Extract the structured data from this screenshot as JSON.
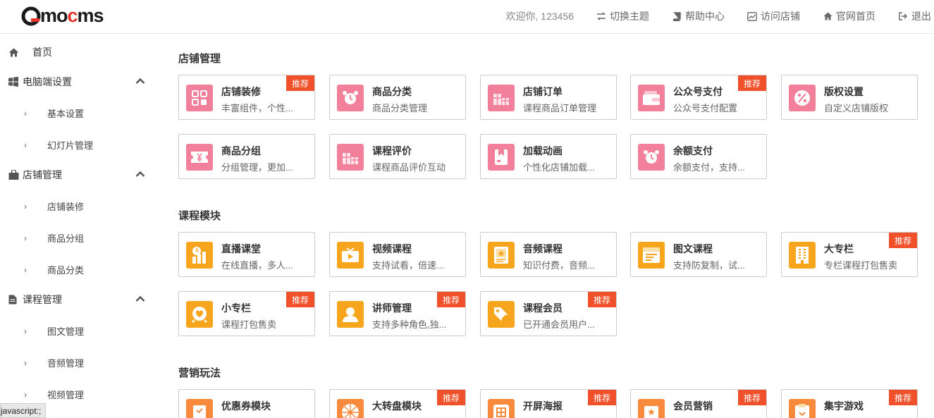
{
  "header": {
    "logo": "Qmocms",
    "welcome": "欢迎你, 123456",
    "switch_theme": "切换主题",
    "help_center": "帮助中心",
    "visit_store": "访问店铺",
    "official_home": "官网首页",
    "logout": "退出"
  },
  "sidebar": {
    "home": "首页",
    "pc_settings": "电脑端设置",
    "pc_basic": "基本设置",
    "pc_slides": "幻灯片管理",
    "store_mgmt": "店铺管理",
    "store_decor": "店铺装修",
    "store_group": "商品分组",
    "store_category": "商品分类",
    "course_mgmt": "课程管理",
    "course_article": "图文管理",
    "course_audio": "音频管理",
    "course_video": "视频管理"
  },
  "status_bar": "javascript:;",
  "badge_label": "推荐",
  "sections": {
    "store": {
      "title": "店铺管理",
      "cards": [
        {
          "title": "店铺装修",
          "desc": "丰富组件，个性...",
          "icon": "qr-grid-icon",
          "badge": true
        },
        {
          "title": "商品分类",
          "desc": "商品分类管理",
          "icon": "alarm-clock-icon",
          "badge": false
        },
        {
          "title": "店铺订单",
          "desc": "课程商品订单管理",
          "icon": "gift-boxes-icon",
          "badge": false
        },
        {
          "title": "公众号支付",
          "desc": "公众号支付配置",
          "icon": "wallet-icon",
          "badge": true
        },
        {
          "title": "版权设置",
          "desc": "自定义店铺版权",
          "icon": "percent-icon",
          "badge": false
        },
        {
          "title": "商品分组",
          "desc": "分组管理，更加...",
          "icon": "yen-ticket-icon",
          "badge": false
        },
        {
          "title": "课程评价",
          "desc": "课程商品评价互动",
          "icon": "gift-boxes-icon",
          "badge": false
        },
        {
          "title": "加载动画",
          "desc": "个性化店铺加载...",
          "icon": "bookmark-icon",
          "badge": false
        },
        {
          "title": "余额支付",
          "desc": "余额支付，支持...",
          "icon": "alarm-clock-icon",
          "badge": false
        }
      ]
    },
    "course": {
      "title": "课程模块",
      "cards": [
        {
          "title": "直播课堂",
          "desc": "在线直播，多人...",
          "icon": "live-chart-icon",
          "badge": false
        },
        {
          "title": "视频课程",
          "desc": "支持试看，倍速...",
          "icon": "tv-play-icon",
          "badge": false
        },
        {
          "title": "音频课程",
          "desc": "知识付费，音频...",
          "icon": "audio-book-icon",
          "badge": false
        },
        {
          "title": "图文课程",
          "desc": "支持防复制，试...",
          "icon": "article-card-icon",
          "badge": false
        },
        {
          "title": "大专栏",
          "desc": "专栏课程打包售卖",
          "icon": "building-icon",
          "badge": true
        },
        {
          "title": "小专栏",
          "desc": "课程打包售卖",
          "icon": "heart-badge-icon",
          "badge": true
        },
        {
          "title": "讲师管理",
          "desc": "支持多种角色,独...",
          "icon": "user-icon",
          "badge": true
        },
        {
          "title": "课程会员",
          "desc": "已开通会员用户...",
          "icon": "tag-icon",
          "badge": true
        }
      ]
    },
    "marketing": {
      "title": "营销玩法",
      "cards": [
        {
          "title": "优惠券模块",
          "desc": "",
          "icon": "coupon-icon",
          "badge": false
        },
        {
          "title": "大转盘模块",
          "desc": "",
          "icon": "wheel-icon",
          "badge": true
        },
        {
          "title": "开屏海报",
          "desc": "",
          "icon": "poster-icon",
          "badge": true
        },
        {
          "title": "会员营销",
          "desc": "",
          "icon": "card-star-icon",
          "badge": true
        },
        {
          "title": "集宇游戏",
          "desc": "",
          "icon": "clipboard-icon",
          "badge": true
        }
      ]
    }
  },
  "colors": {
    "pink": "#f2809a",
    "orange": "#f8a51e",
    "coral": "#f78a3c",
    "badge": "#f0512b"
  }
}
